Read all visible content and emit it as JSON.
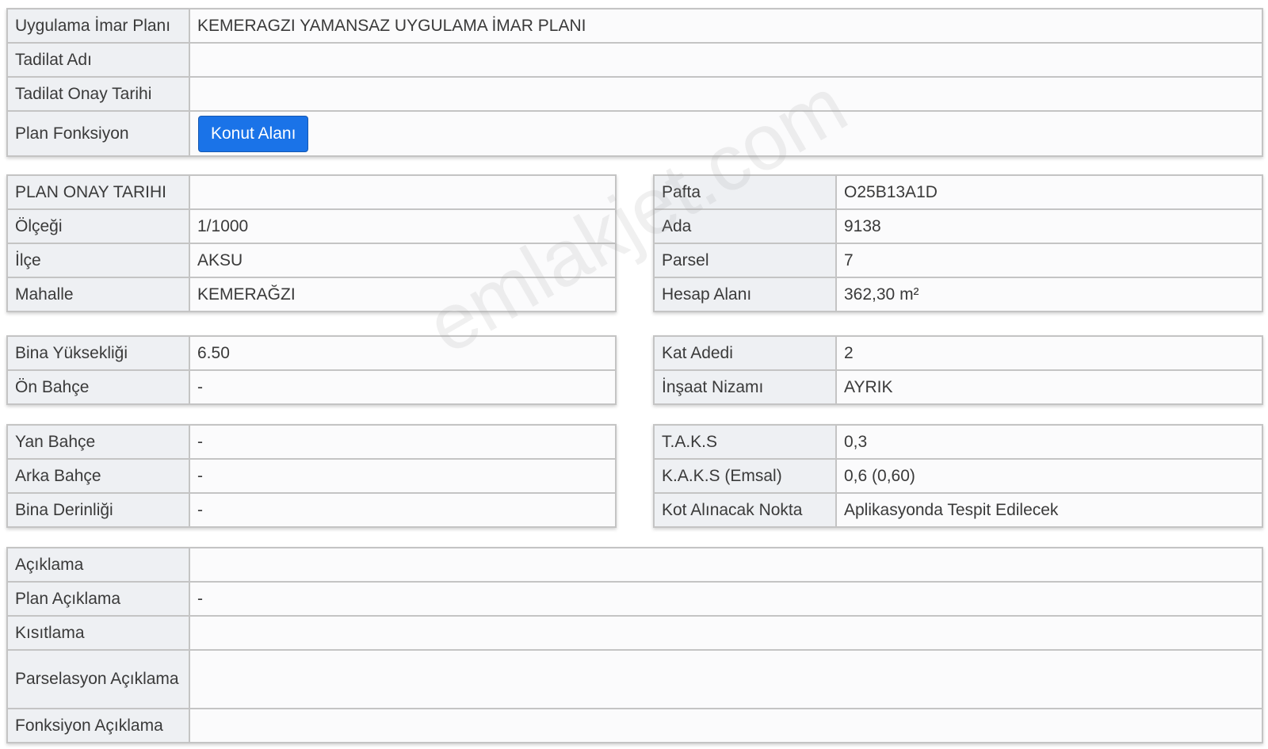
{
  "top": [
    {
      "label": "Uygulama İmar Planı",
      "value": "KEMERAGZI YAMANSAZ UYGULAMA İMAR PLANI"
    },
    {
      "label": "Tadilat Adı",
      "value": ""
    },
    {
      "label": "Tadilat Onay Tarihi",
      "value": ""
    },
    {
      "label": "Plan Fonksiyon",
      "button": "Konut Alanı"
    }
  ],
  "left1": [
    {
      "label": "PLAN ONAY TARIHI",
      "value": ""
    },
    {
      "label": "Ölçeği",
      "value": "1/1000"
    },
    {
      "label": "İlçe",
      "value": "AKSU"
    },
    {
      "label": "Mahalle",
      "value": "KEMERAĞZI"
    }
  ],
  "right1": [
    {
      "label": "Pafta",
      "value": "O25B13A1D"
    },
    {
      "label": "Ada",
      "value": "9138"
    },
    {
      "label": "Parsel",
      "value": "7"
    },
    {
      "label": "Hesap Alanı",
      "value": "362,30 m²"
    }
  ],
  "left2": [
    {
      "label": "Bina Yüksekliği",
      "value": "6.50"
    },
    {
      "label": "Ön Bahçe",
      "value": "-"
    }
  ],
  "right2": [
    {
      "label": "Kat Adedi",
      "value": "2"
    },
    {
      "label": "İnşaat Nizamı",
      "value": "AYRIK"
    }
  ],
  "left3": [
    {
      "label": "Yan Bahçe",
      "value": "-"
    },
    {
      "label": "Arka Bahçe",
      "value": "-"
    },
    {
      "label": "Bina Derinliği",
      "value": "-"
    }
  ],
  "right3": [
    {
      "label": "T.A.K.S",
      "value": "0,3"
    },
    {
      "label": "K.A.K.S (Emsal)",
      "value": "0,6 (0,60)"
    },
    {
      "label": "Kot Alınacak Nokta",
      "value": "Aplikasyonda Tespit Edilecek"
    }
  ],
  "bottom": [
    {
      "label": "Açıklama",
      "value": ""
    },
    {
      "label": "Plan Açıklama",
      "value": "-"
    },
    {
      "label": "Kısıtlama",
      "value": ""
    },
    {
      "label": "Parselasyon Açıklama",
      "value": ""
    },
    {
      "label": "Fonksiyon Açıklama",
      "value": ""
    }
  ],
  "watermark": "emlakjet.com",
  "colors": {
    "button": "#1a73e8",
    "label_bg": "#eef0f3",
    "border": "#c4c4c4"
  }
}
